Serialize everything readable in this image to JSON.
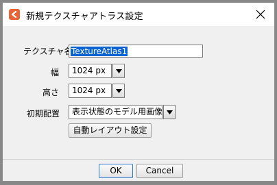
{
  "dialog": {
    "title": "新規テクスチャアトラス設定",
    "app_icon": "app-logo-icon",
    "close_icon": "close-icon"
  },
  "form": {
    "name_label": "テクスチャ名",
    "name_value": "TextureAtlas1",
    "width_label": "幅",
    "width_value": "1024 px",
    "height_label": "高さ",
    "height_value": "1024 px",
    "initial_label": "初期配置",
    "initial_value": "表示状態のモデル用画像",
    "auto_layout_button": "自動レイアウト設定"
  },
  "footer": {
    "ok_label": "OK",
    "cancel_label": "Cancel"
  },
  "colors": {
    "accent": "#0a63d1",
    "app_icon": "#e8653a"
  }
}
